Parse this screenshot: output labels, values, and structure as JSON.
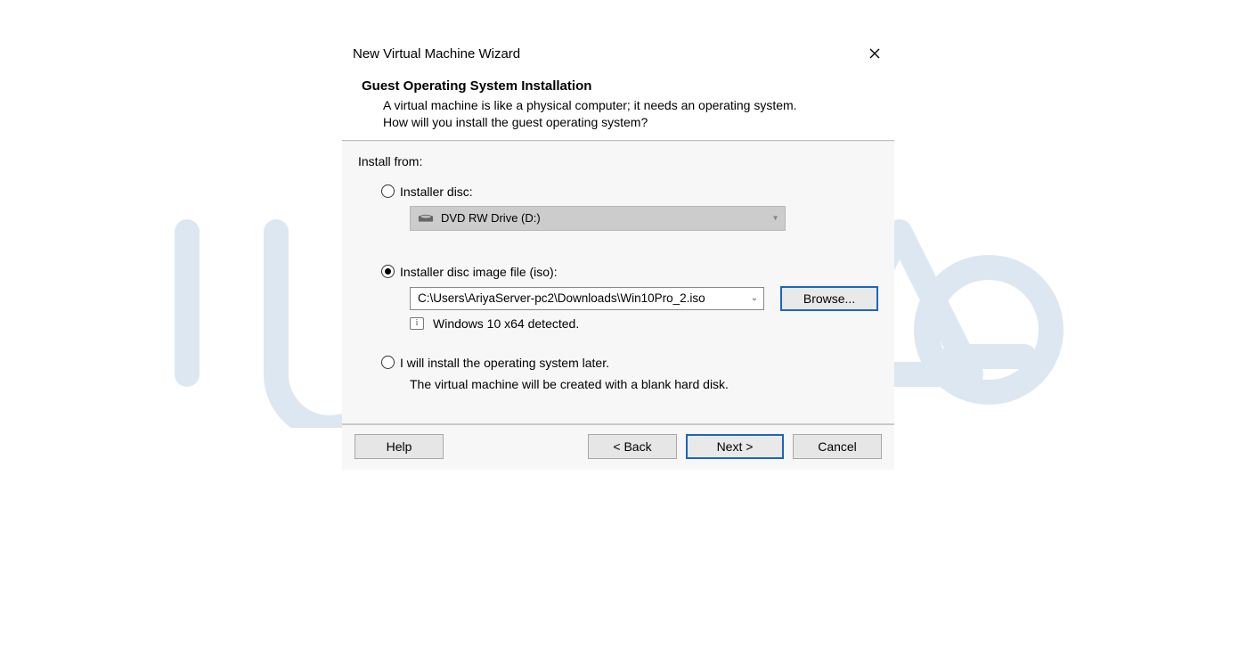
{
  "titlebar": {
    "title": "New Virtual Machine Wizard"
  },
  "header": {
    "title": "Guest Operating System Installation",
    "description": "A virtual machine is like a physical computer; it needs an operating system. How will you install the guest operating system?"
  },
  "body": {
    "install_from_label": "Install from:",
    "option_disc": "Installer disc:",
    "drive_value": "DVD RW Drive (D:)",
    "option_iso": "Installer disc image file (iso):",
    "iso_path": "C:\\Users\\AriyaServer-pc2\\Downloads\\Win10Pro_2.iso",
    "browse_label": "Browse...",
    "detected_text": "Windows 10 x64 detected.",
    "option_later": "I will install the operating system later.",
    "later_desc": "The virtual machine will be created with a blank hard disk."
  },
  "footer": {
    "help": "Help",
    "back": "< Back",
    "next": "Next >",
    "cancel": "Cancel"
  }
}
